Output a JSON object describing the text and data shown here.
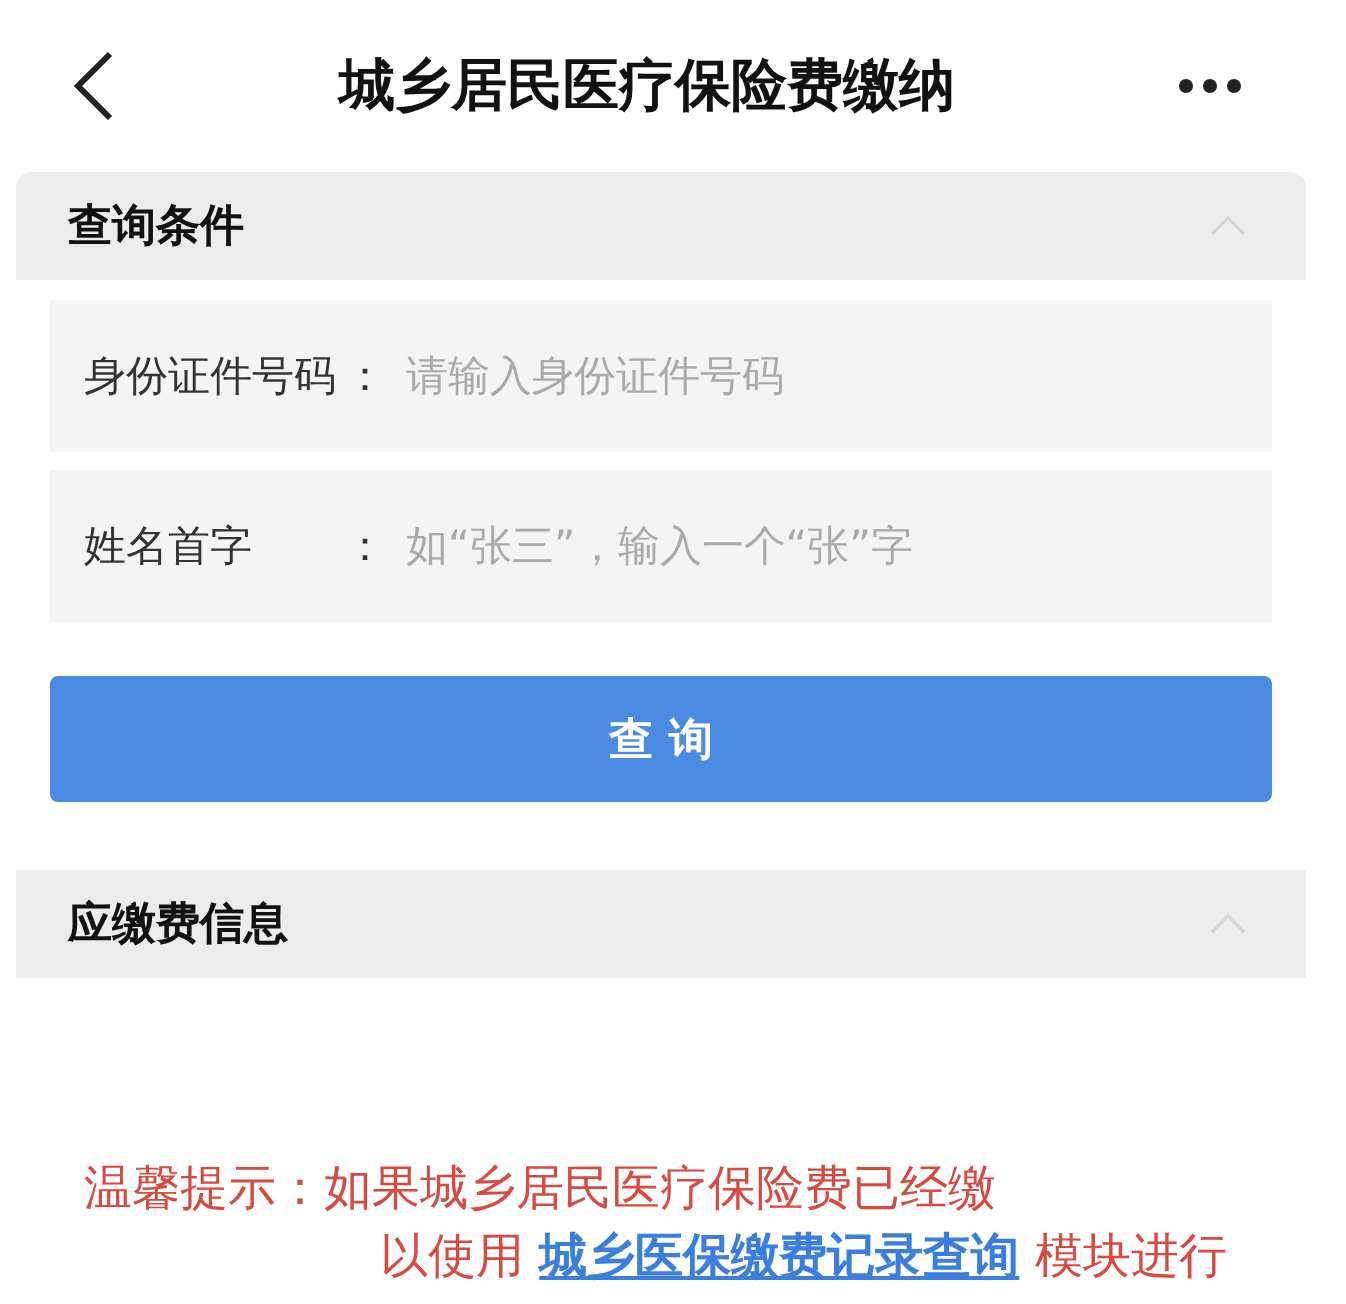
{
  "header": {
    "title": "城乡居民医疗保险费缴纳"
  },
  "query_section": {
    "title": "查询条件",
    "fields": [
      {
        "label": "身份证件号码",
        "separator": "：",
        "placeholder": "请输入身份证件号码"
      },
      {
        "label": "姓名首字",
        "separator": "：",
        "placeholder": "如“张三”，输入一个“张”字"
      }
    ],
    "button": "查 询"
  },
  "fee_section": {
    "title": "应缴费信息"
  },
  "notice": {
    "line_1": "温馨提示：如果城乡居民医疗保险费已经缴",
    "line_2_before": "以使用",
    "link": "城乡医保缴费记录查询",
    "line_2_after": "模块进行"
  }
}
